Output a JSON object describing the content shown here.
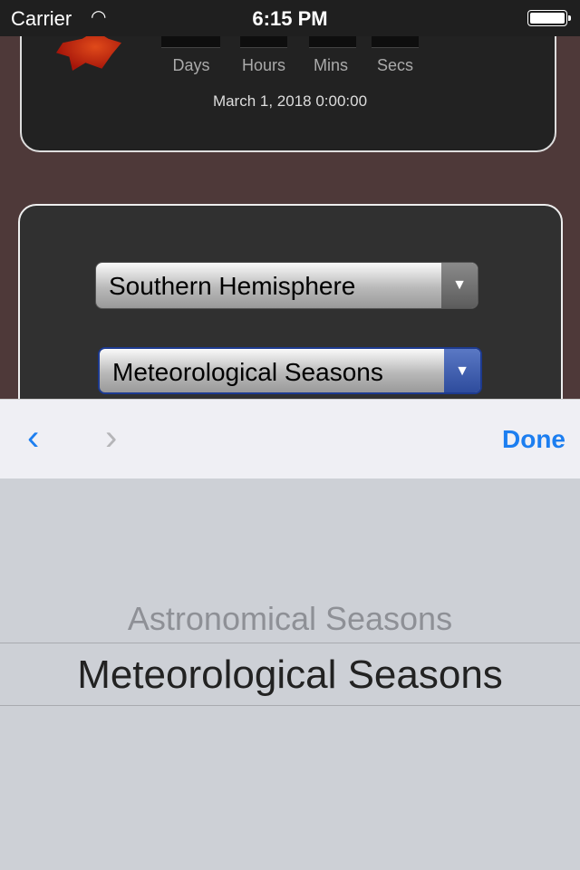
{
  "status_bar": {
    "carrier": "Carrier",
    "time": "6:15 PM",
    "wifi_icon": "wifi-icon",
    "battery_icon": "battery-icon"
  },
  "countdown": {
    "units": [
      "Days",
      "Hours",
      "Mins",
      "Secs"
    ],
    "target_date": "March 1, 2018  0:00:00"
  },
  "settings": {
    "hemisphere_select": "Southern Hemisphere",
    "season_type_select": "Meteorological Seasons"
  },
  "toolbar": {
    "done_label": "Done",
    "prev_icon": "chevron-left-icon",
    "next_icon": "chevron-right-icon"
  },
  "picker": {
    "options": [
      "Astronomical Seasons",
      "Meteorological Seasons"
    ],
    "selected": "Meteorological Seasons"
  },
  "colors": {
    "accent": "#1c7ef0",
    "active_select": "#2e4c9d"
  }
}
